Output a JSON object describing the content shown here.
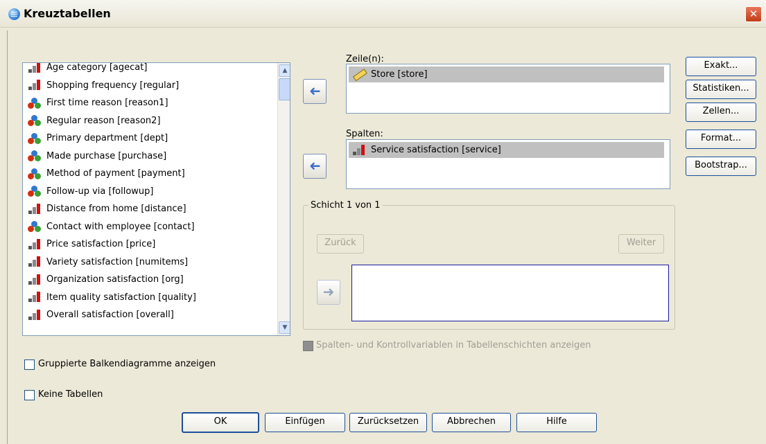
{
  "window": {
    "title": "Kreuztabellen",
    "close_label": "✕"
  },
  "variables": [
    {
      "label": "Age category [agecat]",
      "type": "scale"
    },
    {
      "label": "Shopping frequency [regular]",
      "type": "scale"
    },
    {
      "label": "First time reason [reason1]",
      "type": "nominal"
    },
    {
      "label": "Regular reason [reason2]",
      "type": "nominal"
    },
    {
      "label": "Primary department [dept]",
      "type": "nominal"
    },
    {
      "label": "Made purchase [purchase]",
      "type": "nominal"
    },
    {
      "label": "Method of payment [payment]",
      "type": "nominal"
    },
    {
      "label": "Follow-up via [followup]",
      "type": "nominal"
    },
    {
      "label": "Distance from home [distance]",
      "type": "scale"
    },
    {
      "label": "Contact with employee [contact]",
      "type": "nominal"
    },
    {
      "label": "Price satisfaction [price]",
      "type": "scale"
    },
    {
      "label": "Variety satisfaction [numitems]",
      "type": "scale"
    },
    {
      "label": "Organization satisfaction [org]",
      "type": "scale"
    },
    {
      "label": "Item quality satisfaction [quality]",
      "type": "scale"
    },
    {
      "label": "Overall satisfaction [overall]",
      "type": "scale"
    }
  ],
  "rows": {
    "label": "Zeile(n):",
    "item": "Store [store]"
  },
  "columns": {
    "label": "Spalten:",
    "item": "Service satisfaction [service]"
  },
  "layer": {
    "title": "Schicht 1 von 1",
    "prev": "Zurück",
    "next": "Weiter"
  },
  "layer_checkbox": "Spalten- und Kontrollvariablen in Tabellenschichten anzeigen",
  "side_buttons": {
    "exact": "Exakt...",
    "statistics": "Statistiken...",
    "cells": "Zellen...",
    "format": "Format...",
    "bootstrap": "Bootstrap..."
  },
  "options": {
    "clustered_bar": "Gruppierte Balkendiagramme anzeigen",
    "suppress_tables": "Keine Tabellen"
  },
  "footer": {
    "ok": "OK",
    "paste": "Einfügen",
    "reset": "Zurücksetzen",
    "cancel": "Abbrechen",
    "help": "Hilfe"
  },
  "arrows": {
    "left": "➜",
    "right": "➜"
  }
}
